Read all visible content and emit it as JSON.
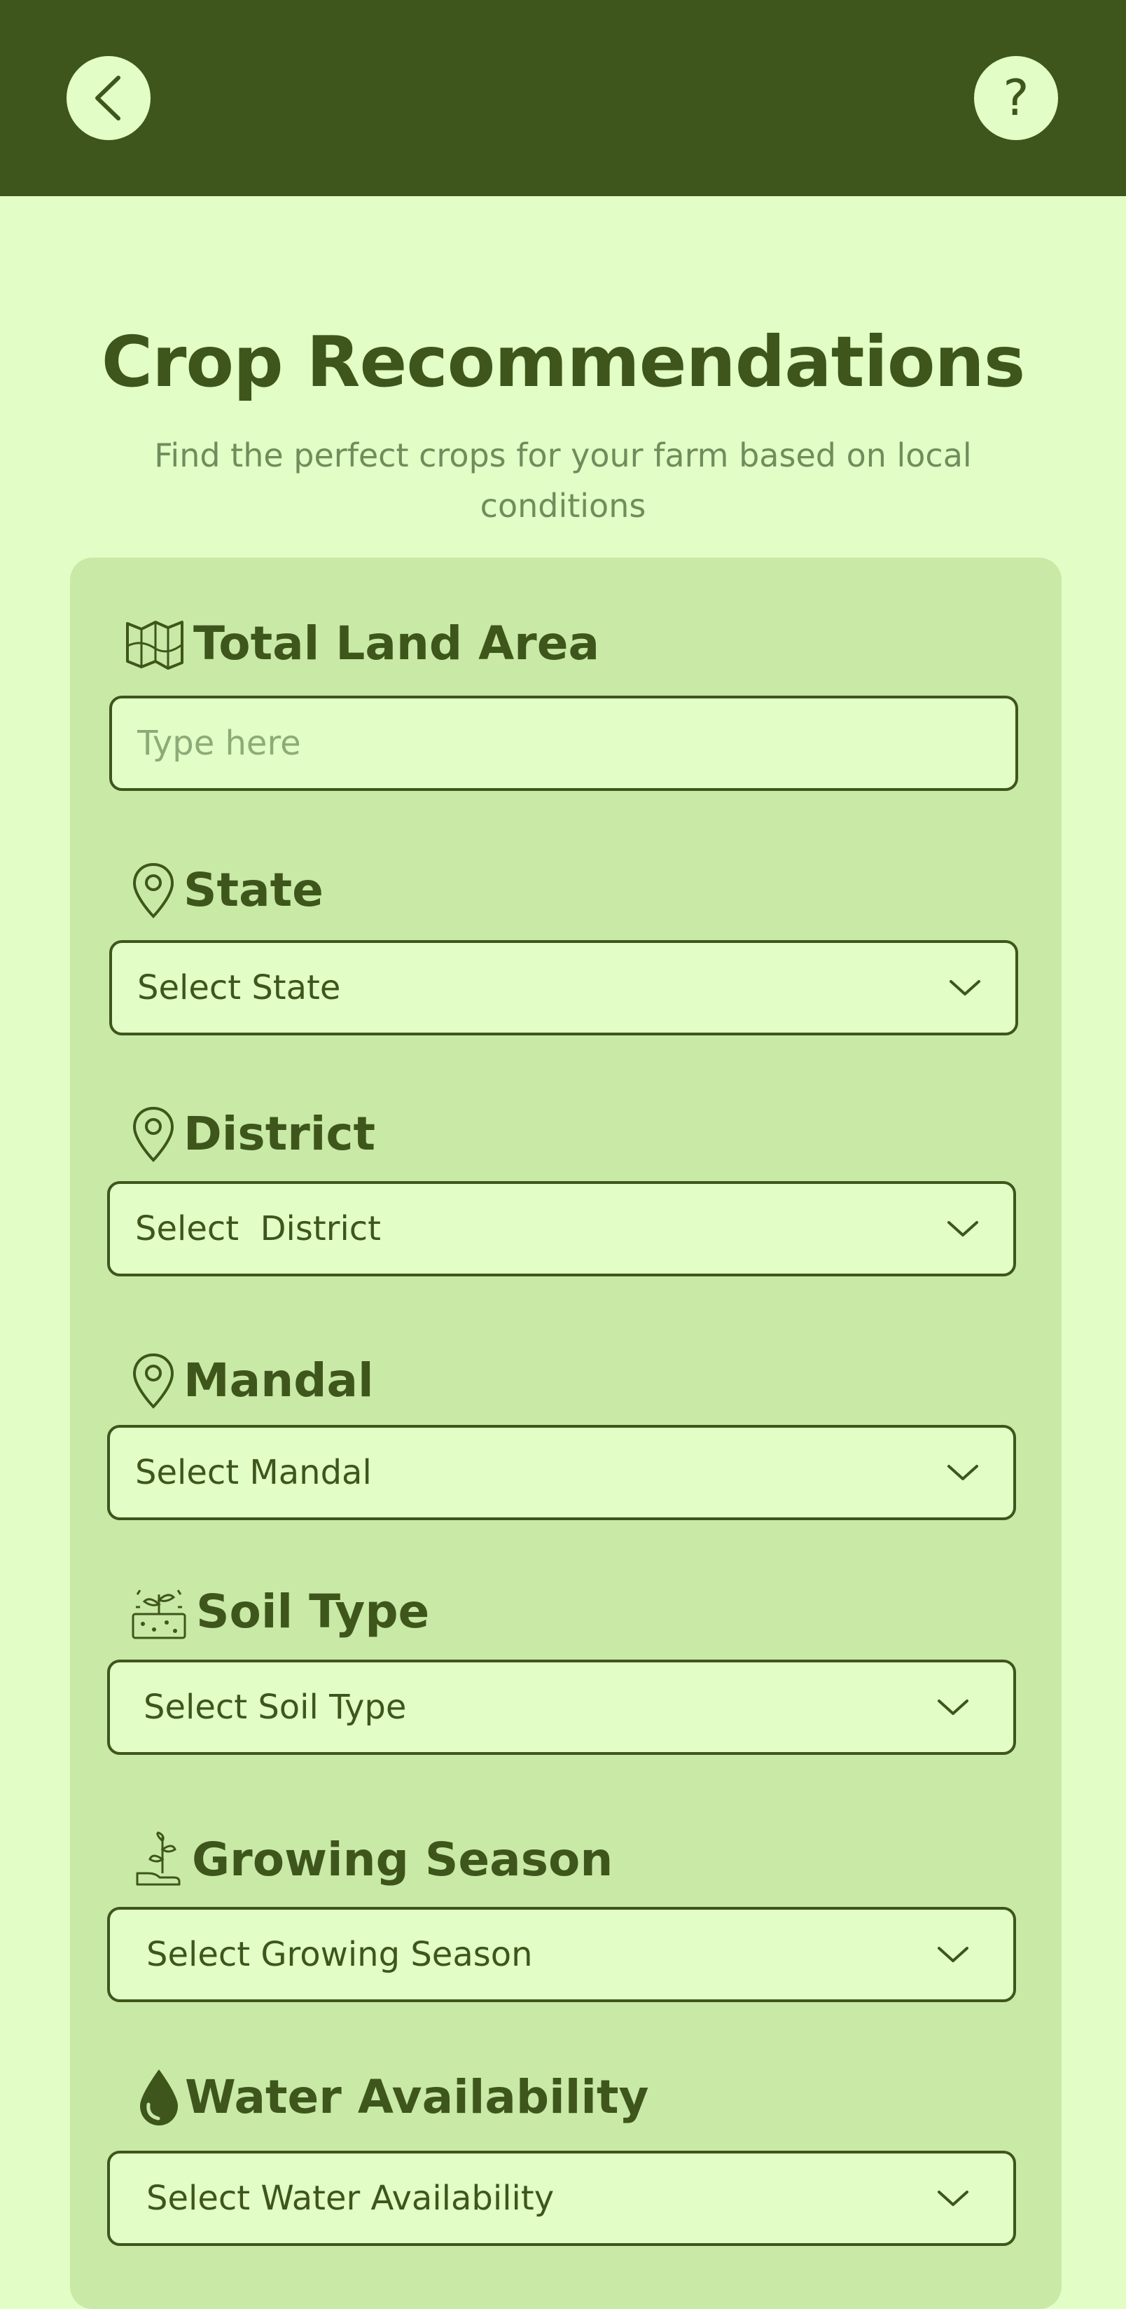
{
  "header": {
    "back_icon": "chevron-left-icon",
    "help_label": "?"
  },
  "page": {
    "title": "Crop Recommendations",
    "subtitle": "Find the perfect crops for your farm based on local conditions"
  },
  "form": {
    "land_area": {
      "label": "Total Land Area",
      "icon": "land-map-icon",
      "placeholder": "Type here",
      "value": ""
    },
    "state": {
      "label": "State",
      "icon": "location-pin-icon",
      "selected": "Select State"
    },
    "district": {
      "label": "District",
      "icon": "location-pin-icon",
      "selected": "Select  District"
    },
    "mandal": {
      "label": "Mandal",
      "icon": "location-pin-icon",
      "selected": "Select Mandal"
    },
    "soil_type": {
      "label": "Soil Type",
      "icon": "soil-sprout-icon",
      "selected": "Select Soil Type"
    },
    "growing_season": {
      "label": "Growing Season",
      "icon": "hand-plant-icon",
      "selected": "Select Growing Season"
    },
    "water_availability": {
      "label": "Water Availability",
      "icon": "water-drop-icon",
      "selected": "Select Water Availability"
    }
  },
  "colors": {
    "header_bg": "#3e561b",
    "page_bg": "#e2fdc5",
    "card_bg": "#c9e9a7",
    "text_primary": "#3e561b",
    "text_muted": "#6f8d5c"
  }
}
